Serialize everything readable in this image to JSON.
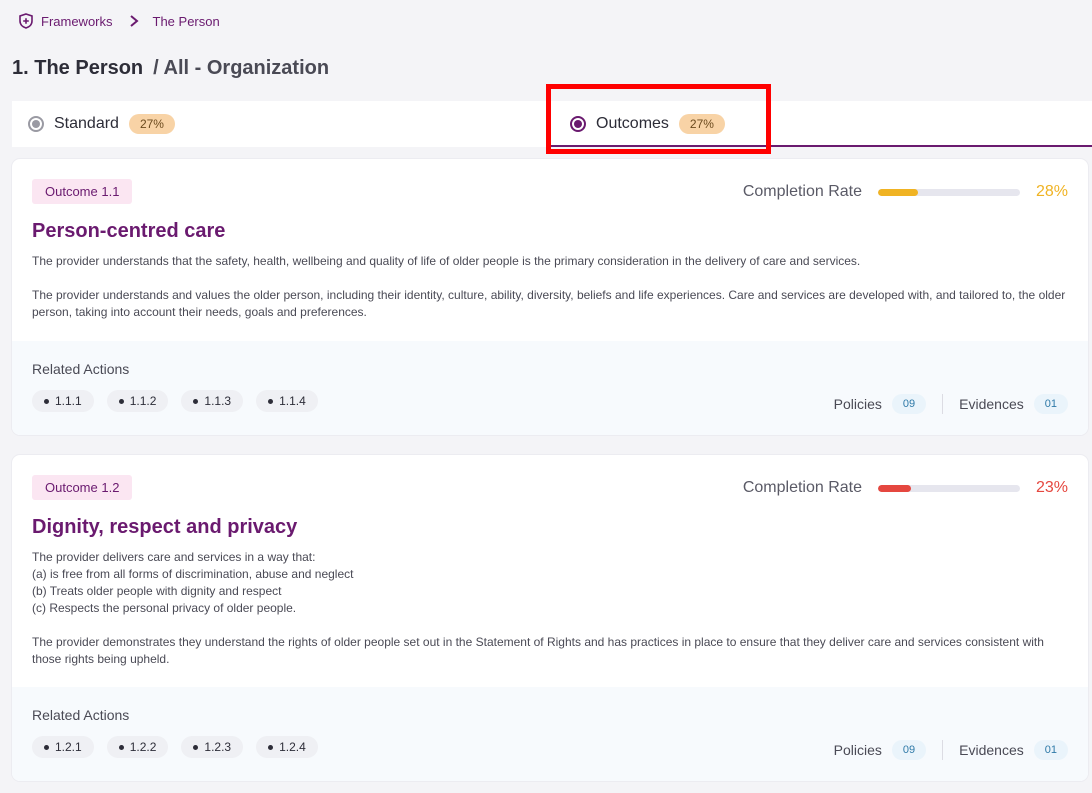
{
  "breadcrumb": {
    "root": "Frameworks",
    "current": "The Person"
  },
  "page": {
    "title": "1. The Person",
    "scope": "/ All - Organization"
  },
  "tabs": [
    {
      "label": "Standard",
      "percent": "27%",
      "selected": false
    },
    {
      "label": "Outcomes",
      "percent": "27%",
      "selected": true
    }
  ],
  "cards": [
    {
      "tag": "Outcome 1.1",
      "completion_label": "Completion Rate",
      "completion_value": "28%",
      "completion_fraction": 0.28,
      "completion_color": "#f0b323",
      "title": "Person-centred care",
      "paragraphs": [
        "The provider understands that the safety, health, wellbeing and quality of life of older people is the primary consideration in the delivery of care and services.",
        "The provider understands and values the older person, including their identity, culture, ability, diversity, beliefs and life experiences. Care and services are developed with, and tailored to, the older person, taking into account their needs, goals and preferences."
      ],
      "related_label": "Related Actions",
      "actions": [
        "1.1.1",
        "1.1.2",
        "1.1.3",
        "1.1.4"
      ],
      "policies_label": "Policies",
      "policies_count": "09",
      "evidences_label": "Evidences",
      "evidences_count": "01"
    },
    {
      "tag": "Outcome 1.2",
      "completion_label": "Completion Rate",
      "completion_value": "23%",
      "completion_fraction": 0.23,
      "completion_color": "#e5473f",
      "title": "Dignity, respect and privacy",
      "paragraphs": [
        "The provider delivers care and services in a way that:\n(a) is free from all forms of discrimination, abuse and neglect\n(b) Treats older people with dignity and respect\n(c) Respects the personal privacy of older people.",
        "The provider demonstrates they understand the rights of older people set out in the Statement of Rights and has practices in place to ensure that they deliver care and services consistent with those rights being upheld."
      ],
      "related_label": "Related Actions",
      "actions": [
        "1.2.1",
        "1.2.2",
        "1.2.3",
        "1.2.4"
      ],
      "policies_label": "Policies",
      "policies_count": "09",
      "evidences_label": "Evidences",
      "evidences_count": "01"
    }
  ],
  "colors": {
    "brand": "#6a1a6f",
    "badge_orange": "#f8d3a6",
    "highlight": "#ff0000"
  }
}
